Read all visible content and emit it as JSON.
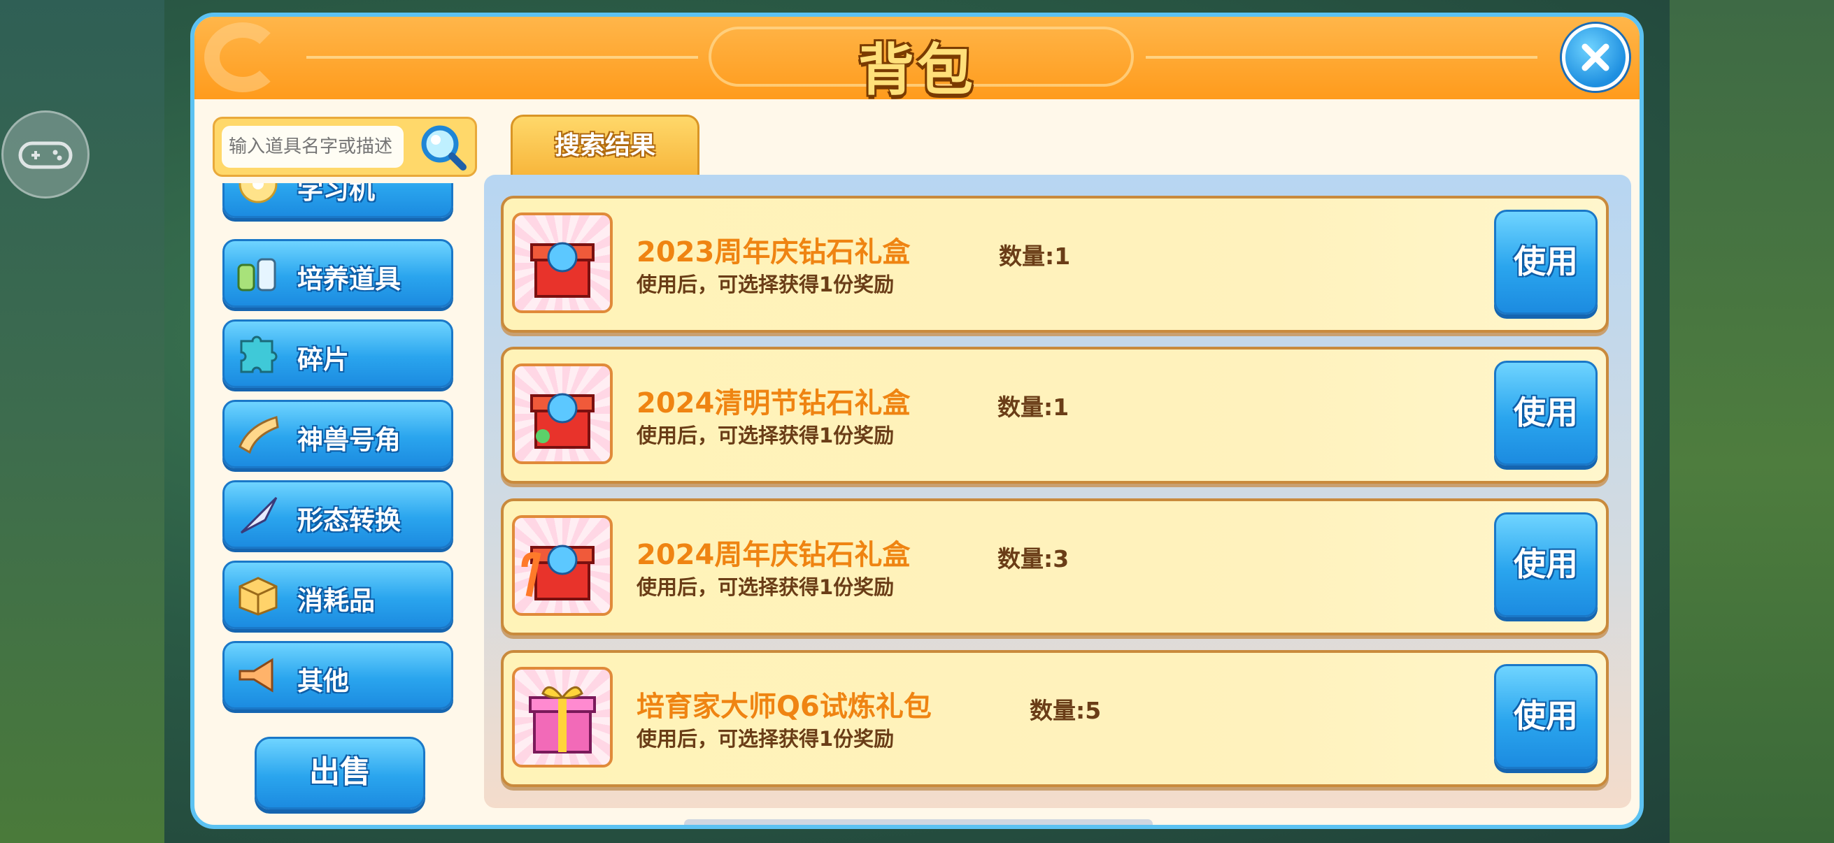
{
  "window": {
    "title": "背包"
  },
  "search": {
    "placeholder": "输入道具名字或描述"
  },
  "categories": [
    {
      "label": "学习机",
      "icon": "disc-icon"
    },
    {
      "label": "培养道具",
      "icon": "potion-bottles-icon"
    },
    {
      "label": "碎片",
      "icon": "puzzle-piece-icon"
    },
    {
      "label": "神兽号角",
      "icon": "horn-icon"
    },
    {
      "label": "形态转换",
      "icon": "transform-arrow-icon"
    },
    {
      "label": "消耗品",
      "icon": "box-icon"
    },
    {
      "label": "其他",
      "icon": "megaphone-icon"
    }
  ],
  "sell_button": {
    "label": "出售"
  },
  "tabs": [
    {
      "label": "搜索结果"
    }
  ],
  "items": [
    {
      "name": "2023周年庆钻石礼盒",
      "desc": "使用后，可选择获得1份奖励",
      "qty": "数量:1",
      "button": "使用",
      "icon": "gift-box-icon"
    },
    {
      "name": "2024清明节钻石礼盒",
      "desc": "使用后，可选择获得1份奖励",
      "qty": "数量:1",
      "button": "使用",
      "icon": "gift-box-icon"
    },
    {
      "name": "2024周年庆钻石礼盒",
      "desc": "使用后，可选择获得1份奖励",
      "qty": "数量:3",
      "button": "使用",
      "icon": "gift-box-icon"
    },
    {
      "name": "培育家大师Q6试炼礼包",
      "desc": "使用后，可选择获得1份奖励",
      "qty": "数量:5",
      "button": "使用",
      "icon": "gift-package-icon"
    }
  ],
  "colors": {
    "accent_blue": "#2aa5ee",
    "title_orange": "#ff9b1c",
    "item_name": "#ef8412"
  }
}
